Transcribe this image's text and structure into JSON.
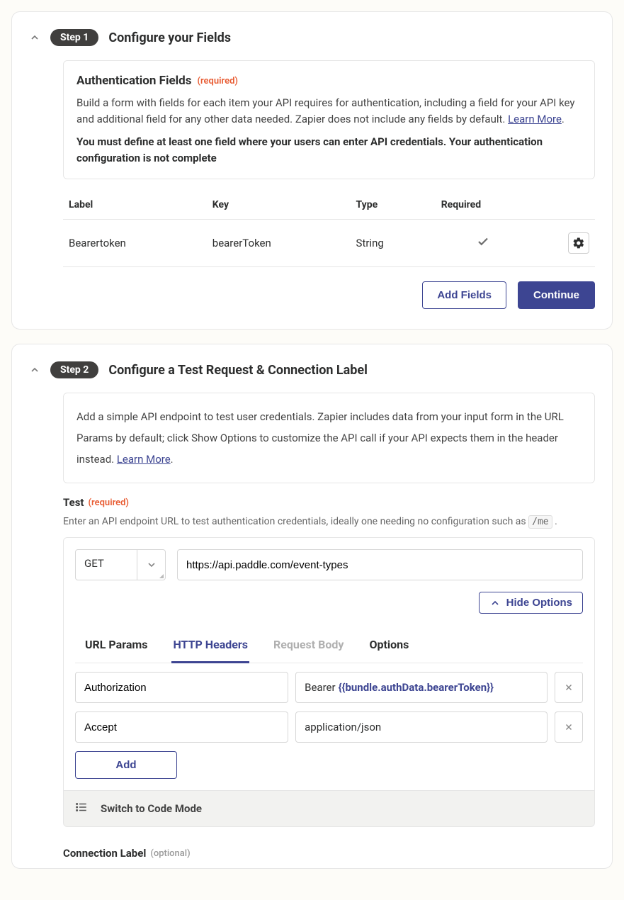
{
  "step1": {
    "badge": "Step 1",
    "title": "Configure your Fields",
    "box": {
      "heading": "Authentication Fields",
      "required": "(required)",
      "desc_prefix": "Build a form with fields for each item your API requires for authentication, including a field for your API key and additional field for any other data needed. Zapier does not include any fields by default. ",
      "learn_more": "Learn More",
      "desc_suffix": ".",
      "warn": "You must define at least one field where your users can enter API credentials. Your authentication configuration is not complete"
    },
    "columns": {
      "label": "Label",
      "key": "Key",
      "type": "Type",
      "required": "Required"
    },
    "row": {
      "label": "Bearertoken",
      "key": "bearerToken",
      "type": "String"
    },
    "add_fields": "Add Fields",
    "continue": "Continue"
  },
  "step2": {
    "badge": "Step 2",
    "title": "Configure a Test Request & Connection Label",
    "box": {
      "desc_prefix": "Add a simple API endpoint to test user credentials. Zapier includes data from your input form in the URL Params by default; click Show Options to customize the API call if your API expects them in the header instead. ",
      "learn_more": "Learn More",
      "desc_suffix": "."
    },
    "test_label": "Test",
    "test_required": "(required)",
    "hint_prefix": "Enter an API endpoint URL to test authentication credentials, ideally one needing no configuration such as ",
    "hint_code": "/me",
    "hint_suffix": " .",
    "method": "GET",
    "url": "https://api.paddle.com/event-types",
    "hide_options": "Hide Options",
    "tabs": {
      "url_params": "URL Params",
      "http_headers": "HTTP Headers",
      "request_body": "Request Body",
      "options": "Options"
    },
    "headers": [
      {
        "key": "Authorization",
        "val_prefix": "Bearer ",
        "val_var": "{{bundle.authData.bearerToken}}"
      },
      {
        "key": "Accept",
        "val_prefix": "application/json",
        "val_var": ""
      }
    ],
    "add": "Add",
    "code_mode": "Switch to Code Mode",
    "conn_label": "Connection Label",
    "conn_optional": "(optional)"
  }
}
